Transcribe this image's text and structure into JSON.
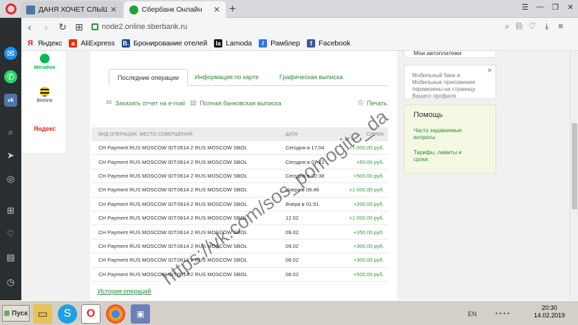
{
  "browser": {
    "tabs": [
      {
        "title": "ДАНЯ ХОЧЕТ СЛЫШАТЬ ДЕ",
        "icon": "vk-icon",
        "active": false
      },
      {
        "title": "Сбербанк Онлайн",
        "icon": "sberbank-icon",
        "active": true
      }
    ],
    "new_tab_label": "+",
    "url": "node2.online.sberbank.ru",
    "bookmarks": [
      {
        "label": "Яндекс",
        "icon": "yandex-icon",
        "glyph": "Я",
        "color": "#e52620"
      },
      {
        "label": "AliExpress",
        "icon": "aliexpress-icon",
        "glyph": "a",
        "color": "#e62e04"
      },
      {
        "label": "Бронирование отелей",
        "icon": "booking-icon",
        "glyph": "B.",
        "color": "#1e4b8a"
      },
      {
        "label": "Lamoda",
        "icon": "lamoda-icon",
        "glyph": "la",
        "color": "#111111"
      },
      {
        "label": "Рамблер",
        "icon": "rambler-icon",
        "glyph": "/",
        "color": "#3173e8"
      },
      {
        "label": "Facebook",
        "icon": "facebook-icon",
        "glyph": "f",
        "color": "#3b5998"
      }
    ]
  },
  "partners": [
    "МегаФон",
    "Beeline",
    "Яндекс"
  ],
  "operations": {
    "tabs": [
      "Последние операции",
      "Информация по карте",
      "Графическая выписка"
    ],
    "actions": {
      "email": "Заказать отчет на e-mail",
      "full": "Полная банковская выписка",
      "print": "Печать"
    },
    "columns": [
      "ВИД ОПЕРАЦИИ, МЕСТО СОВЕРШЕНИЯ",
      "ДАТА",
      "СУММА"
    ],
    "rows": [
      {
        "desc": "CH Payment RUS MOSCOW IDT:0614 2 RUS MOSCOW SBOL",
        "date": "Сегодня в 17:04",
        "amount": "+1 000,00 руб."
      },
      {
        "desc": "CH Payment RUS MOSCOW IDT:0614 2 RUS MOSCOW SBOL",
        "date": "Сегодня в 07:21",
        "amount": "+50,00 руб."
      },
      {
        "desc": "CH Payment RUS MOSCOW IDT:0614 2 RUS MOSCOW SBOL",
        "date": "Сегодня в 02:38",
        "amount": "+500,00 руб."
      },
      {
        "desc": "CH Payment RUS MOSCOW IDT:0614 2 RUS MOSCOW SBOL",
        "date": "Вчера в 09:46",
        "amount": "+1 000,00 руб."
      },
      {
        "desc": "CH Payment RUS MOSCOW IDT:0614 2 RUS MOSCOW SBOL",
        "date": "Вчера в 01:51",
        "amount": "+200,00 руб."
      },
      {
        "desc": "CH Payment RUS MOSCOW IDT:0614 2 RUS MOSCOW SBOL",
        "date": "12.02",
        "amount": "+1 000,00 руб."
      },
      {
        "desc": "CH Payment RUS MOSCOW IDT:0614 2 RUS MOSCOW SBOL",
        "date": "09.02",
        "amount": "+350,00 руб."
      },
      {
        "desc": "CH Payment RUS MOSCOW IDT:0614 2 RUS MOSCOW SBOL",
        "date": "09.02",
        "amount": "+300,00 руб."
      },
      {
        "desc": "CH Payment RUS MOSCOW IDT:0614 2 RUS MOSCOW SBOL",
        "date": "08.02",
        "amount": "+300,00 руб."
      },
      {
        "desc": "CH Payment RUS MOSCOW IDT:0614 2 RUS MOSCOW SBOL",
        "date": "08.02",
        "amount": "+500,00 руб."
      }
    ],
    "history_link": "История операций"
  },
  "right": {
    "autopay": "Мои автоплатежи",
    "notice": "Мобильный банк и Мобильные приложения перевезены на страницу Вашего профиля",
    "help_title": "Помощь",
    "help_links": [
      "Часто задаваемые вопросы",
      "Тарифы, лимиты и сроки"
    ]
  },
  "watermark": "https://vk.com/sos_pomogite_da",
  "taskbar": {
    "start_label": "Пуск",
    "lang": "EN",
    "time": "20:30",
    "date": "14.02.2019"
  }
}
